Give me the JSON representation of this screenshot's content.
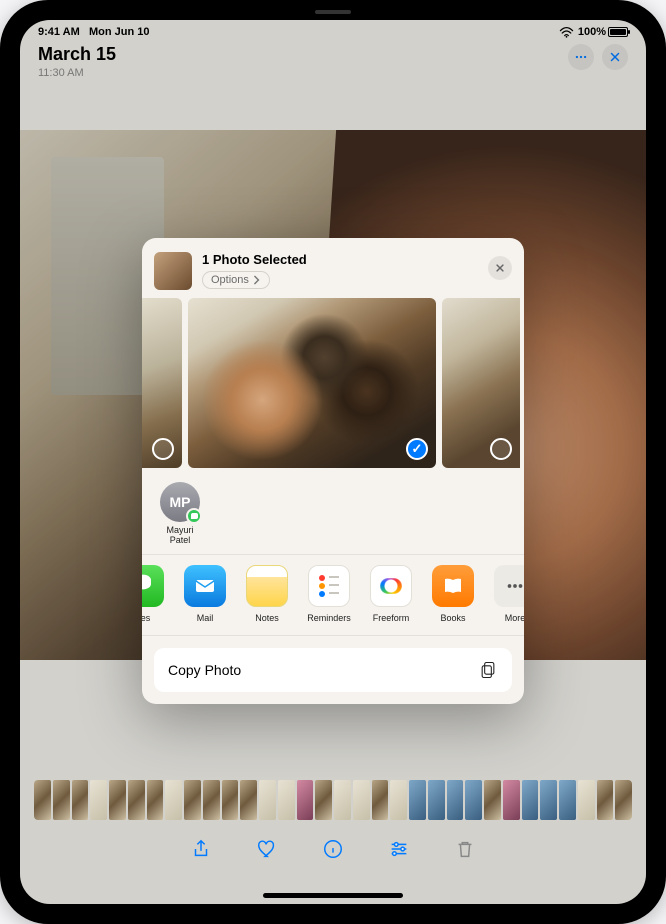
{
  "status": {
    "time": "9:41 AM",
    "date": "Mon Jun 10",
    "battery_pct": "100%"
  },
  "header": {
    "title": "March 15",
    "subtitle": "11:30 AM"
  },
  "share": {
    "title": "1 Photo Selected",
    "options_label": "Options",
    "selected_index": 1,
    "contacts": [
      {
        "initials": "MP",
        "name": "Mayuri Patel"
      }
    ],
    "apps": [
      {
        "key": "messages",
        "label": "ges"
      },
      {
        "key": "mail",
        "label": "Mail"
      },
      {
        "key": "notes",
        "label": "Notes"
      },
      {
        "key": "reminders",
        "label": "Reminders"
      },
      {
        "key": "freeform",
        "label": "Freeform"
      },
      {
        "key": "books",
        "label": "Books"
      },
      {
        "key": "more",
        "label": "More"
      }
    ],
    "action_label": "Copy Photo"
  }
}
